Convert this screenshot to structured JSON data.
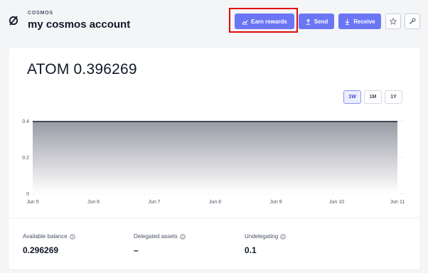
{
  "header": {
    "network": "COSMOS",
    "account_name": "my cosmos account",
    "icon": "slashed-circle-icon"
  },
  "actions": {
    "earn_label": "Earn rewards",
    "send_label": "Send",
    "receive_label": "Receive",
    "accent": "#6b76f5",
    "highlight_color": "#e10b0b"
  },
  "balance": {
    "ticker": "ATOM",
    "amount": "0.396269"
  },
  "ranges": [
    {
      "label": "1W",
      "active": true
    },
    {
      "label": "1M",
      "active": false
    },
    {
      "label": "1Y",
      "active": false
    }
  ],
  "chart_data": {
    "type": "area",
    "x": [
      "Jun 5",
      "Jun 6",
      "Jun 7",
      "Jun 8",
      "Jun 9",
      "Jun 10",
      "Jun 11"
    ],
    "series": [
      {
        "values": [
          0.396269,
          0.396269,
          0.396269,
          0.396269,
          0.396269,
          0.396269,
          0.396269
        ]
      }
    ],
    "yticks": [
      "0.4",
      "0.2",
      "0"
    ],
    "ylim": [
      0,
      0.4
    ],
    "grid": "dashed-horizontal"
  },
  "stats": [
    {
      "label": "Available balance",
      "value": "0.296269"
    },
    {
      "label": "Delegated assets",
      "value": "–"
    },
    {
      "label": "Undelegating",
      "value": "0.1"
    }
  ]
}
